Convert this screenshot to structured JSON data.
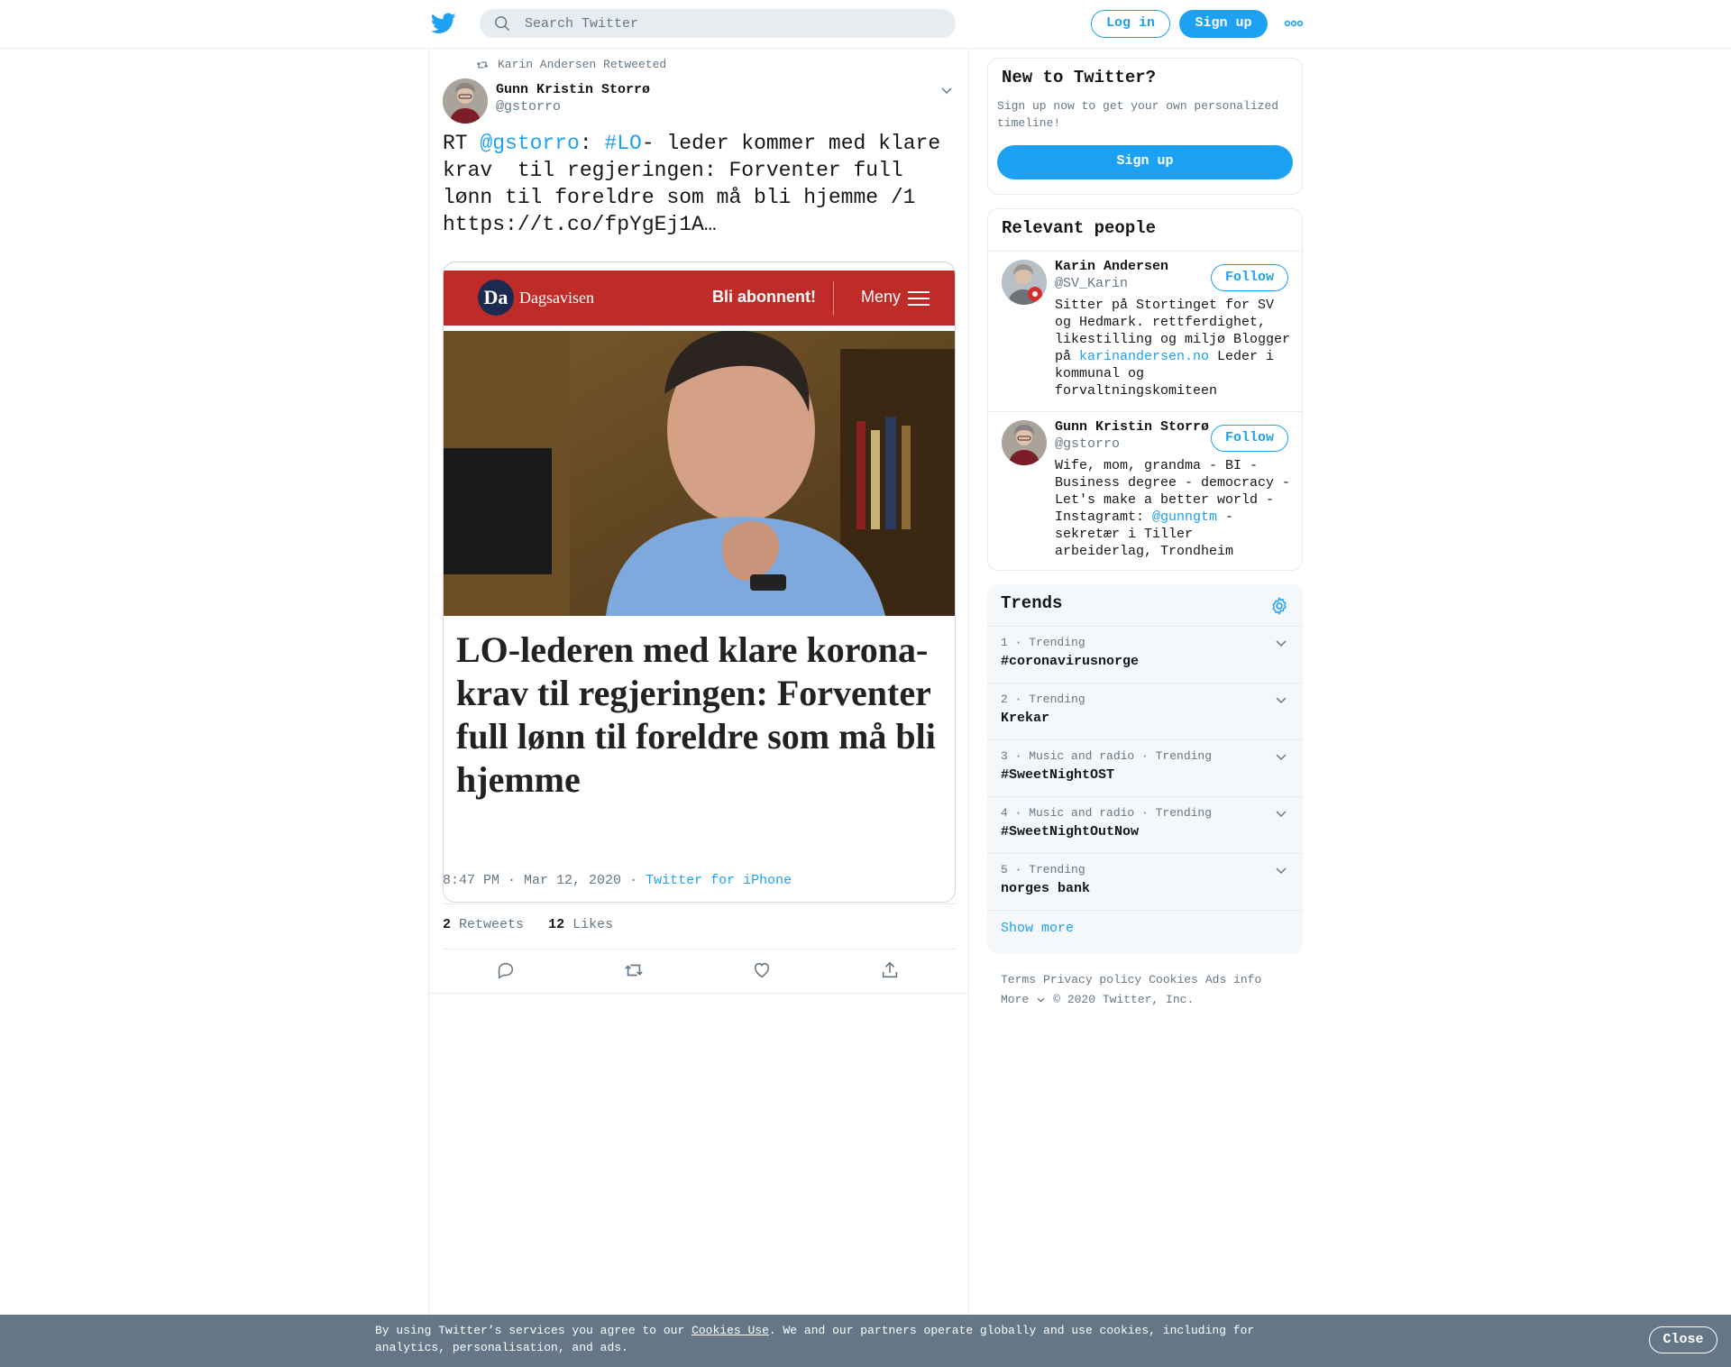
{
  "header": {
    "search_placeholder": "Search Twitter",
    "login_label": "Log in",
    "signup_label": "Sign up"
  },
  "tweet": {
    "retweeted_by": "Karin Andersen Retweeted",
    "author_name": "Gunn Kristin Storrø",
    "author_handle": "@gstorro",
    "text_prefix": "RT ",
    "mention": "@gstorro",
    "colon": ": ",
    "hashtag": "#LO",
    "text_rest": "- leder kommer med klare krav  til regjeringen: Forventer full lønn til foreldre som må bli hjemme /1 https://t.co/fpYgEj1A…",
    "card": {
      "site_name": "Dagsavisen",
      "logo_letters": "Da",
      "subscribe_label": "Bli abonnent!",
      "menu_label": "Meny",
      "headline": "LO-lederen med klare korona-krav til regjeringen: Forventer full lønn til foreldre som må bli hjemme"
    },
    "timestamp": "8:47 PM · Mar 12, 2020",
    "separator": " · ",
    "source": "Twitter for iPhone",
    "retweets_count": "2",
    "retweets_label": "Retweets",
    "likes_count": "12",
    "likes_label": "Likes"
  },
  "sidebar": {
    "new_to_twitter": {
      "title": "New to Twitter?",
      "text": "Sign up now to get your own personalized timeline!",
      "button": "Sign up"
    },
    "relevant_people": {
      "title": "Relevant people",
      "people": [
        {
          "name": "Karin Andersen",
          "handle": "@SV_Karin",
          "follow": "Follow",
          "bio_1": "Sitter på Stortinget for SV og Hedmark. rettferdighet, likestilling og miljø Blogger på ",
          "bio_link": "karinandersen.no",
          "bio_2": " Leder i kommunal og forvaltningskomiteen"
        },
        {
          "name": "Gunn Kristin Storrø",
          "handle": "@gstorro",
          "follow": "Follow",
          "bio_1": "Wife, mom, grandma - BI - Business degree - democracy - Let's make a better world - Instagramt: ",
          "bio_link": "@gunngtm",
          "bio_2": " - sekretær i Tiller arbeiderlag, Trondheim"
        }
      ]
    },
    "trends": {
      "title": "Trends",
      "items": [
        {
          "meta": "1 · Trending",
          "name": "#coronavirusnorge"
        },
        {
          "meta": "2 · Trending",
          "name": "Krekar"
        },
        {
          "meta": "3 · Music and radio · Trending",
          "name": "#SweetNightOST"
        },
        {
          "meta": "4 · Music and radio · Trending",
          "name": "#SweetNightOutNow"
        },
        {
          "meta": "5 · Trending",
          "name": "norges bank"
        }
      ],
      "show_more": "Show more"
    },
    "footer": {
      "terms": "Terms",
      "privacy": "Privacy policy",
      "cookies": "Cookies",
      "ads": "Ads info",
      "more": "More",
      "copyright": "© 2020 Twitter, Inc."
    }
  },
  "cookie_banner": {
    "text_1": "By using Twitter’s services you agree to our ",
    "link": "Cookies Use",
    "text_2": ". We and our partners operate globally and use cookies, including for analytics, personalisation, and ads.",
    "close": "Close"
  },
  "colors": {
    "brand_blue": "#1da1f2",
    "secondary_text": "#657786",
    "dagsavisen_red": "#bf2b27",
    "cookie_banner": "#657786"
  },
  "icons": [
    "twitter-bird-icon",
    "search-icon",
    "more-dots-icon",
    "retweet-icon",
    "chevron-down-icon",
    "reply-icon",
    "like-icon",
    "share-icon",
    "gear-icon",
    "hamburger-icon"
  ]
}
